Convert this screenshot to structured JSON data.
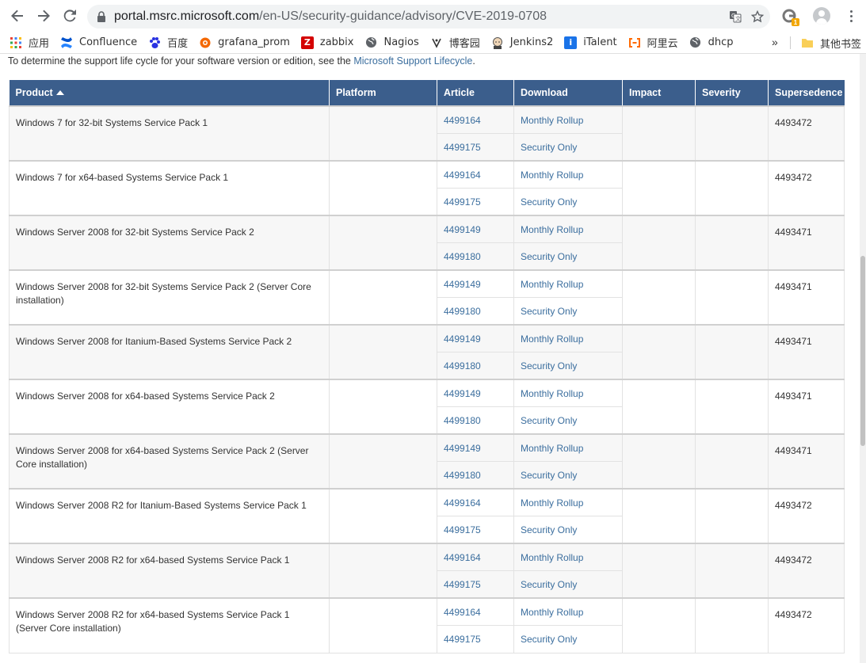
{
  "browser": {
    "url_host": "portal.msrc.microsoft.com",
    "url_path": "/en-US/security-guidance/advisory/CVE-2019-0708",
    "extension_badge": "1",
    "bookmarks": [
      {
        "label": "应用",
        "icon": "apps-grid-icon"
      },
      {
        "label": "Confluence",
        "icon": "confluence-icon"
      },
      {
        "label": "百度",
        "icon": "baidu-paw-icon"
      },
      {
        "label": "grafana_prom",
        "icon": "grafana-icon"
      },
      {
        "label": "zabbix",
        "icon": "zabbix-icon"
      },
      {
        "label": "Nagios",
        "icon": "globe-icon"
      },
      {
        "label": "博客园",
        "icon": "cnblogs-icon"
      },
      {
        "label": "Jenkins2",
        "icon": "jenkins-icon"
      },
      {
        "label": "iTalent",
        "icon": "italent-icon"
      },
      {
        "label": "阿里云",
        "icon": "aliyun-icon"
      },
      {
        "label": "dhcp",
        "icon": "globe-icon"
      }
    ],
    "bookmarks_more": "»",
    "other_bookmarks": "其他书签"
  },
  "page": {
    "intro_text": "To determine the support life cycle for your software version or edition, see the ",
    "intro_link": "Microsoft Support Lifecycle",
    "intro_end": ".",
    "columns": [
      "Product",
      "Platform",
      "Article",
      "Download",
      "Impact",
      "Severity",
      "Supersedence"
    ],
    "rows": [
      {
        "product": "Windows 7 for 32-bit Systems Service Pack 1",
        "platform": "",
        "supersedence": "4493472",
        "updates": [
          {
            "article": "4499164",
            "download": "Monthly Rollup"
          },
          {
            "article": "4499175",
            "download": "Security Only"
          }
        ]
      },
      {
        "product": "Windows 7 for x64-based Systems Service Pack 1",
        "platform": "",
        "supersedence": "4493472",
        "updates": [
          {
            "article": "4499164",
            "download": "Monthly Rollup"
          },
          {
            "article": "4499175",
            "download": "Security Only"
          }
        ]
      },
      {
        "product": "Windows Server 2008 for 32-bit Systems Service Pack 2",
        "platform": "",
        "supersedence": "4493471",
        "updates": [
          {
            "article": "4499149",
            "download": "Monthly Rollup"
          },
          {
            "article": "4499180",
            "download": "Security Only"
          }
        ]
      },
      {
        "product": "Windows Server 2008 for 32-bit Systems Service Pack 2 (Server Core installation)",
        "platform": "",
        "supersedence": "4493471",
        "updates": [
          {
            "article": "4499149",
            "download": "Monthly Rollup"
          },
          {
            "article": "4499180",
            "download": "Security Only"
          }
        ]
      },
      {
        "product": "Windows Server 2008 for Itanium-Based Systems Service Pack 2",
        "platform": "",
        "supersedence": "4493471",
        "updates": [
          {
            "article": "4499149",
            "download": "Monthly Rollup"
          },
          {
            "article": "4499180",
            "download": "Security Only"
          }
        ]
      },
      {
        "product": "Windows Server 2008 for x64-based Systems Service Pack 2",
        "platform": "",
        "supersedence": "4493471",
        "updates": [
          {
            "article": "4499149",
            "download": "Monthly Rollup"
          },
          {
            "article": "4499180",
            "download": "Security Only"
          }
        ]
      },
      {
        "product": "Windows Server 2008 for x64-based Systems Service Pack 2 (Server Core installation)",
        "platform": "",
        "supersedence": "4493471",
        "updates": [
          {
            "article": "4499149",
            "download": "Monthly Rollup"
          },
          {
            "article": "4499180",
            "download": "Security Only"
          }
        ]
      },
      {
        "product": "Windows Server 2008 R2 for Itanium-Based Systems Service Pack 1",
        "platform": "",
        "supersedence": "4493472",
        "updates": [
          {
            "article": "4499164",
            "download": "Monthly Rollup"
          },
          {
            "article": "4499175",
            "download": "Security Only"
          }
        ]
      },
      {
        "product": "Windows Server 2008 R2 for x64-based Systems Service Pack 1",
        "platform": "",
        "supersedence": "4493472",
        "updates": [
          {
            "article": "4499164",
            "download": "Monthly Rollup"
          },
          {
            "article": "4499175",
            "download": "Security Only"
          }
        ]
      },
      {
        "product": "Windows Server 2008 R2 for x64-based Systems Service Pack 1 (Server Core installation)",
        "platform": "",
        "supersedence": "4493472",
        "updates": [
          {
            "article": "4499164",
            "download": "Monthly Rollup"
          },
          {
            "article": "4499175",
            "download": "Security Only"
          }
        ]
      }
    ]
  },
  "colors": {
    "header_bg": "#3b5e8c",
    "link": "#3b6e9e",
    "row_alt": "#f7f7f7"
  }
}
